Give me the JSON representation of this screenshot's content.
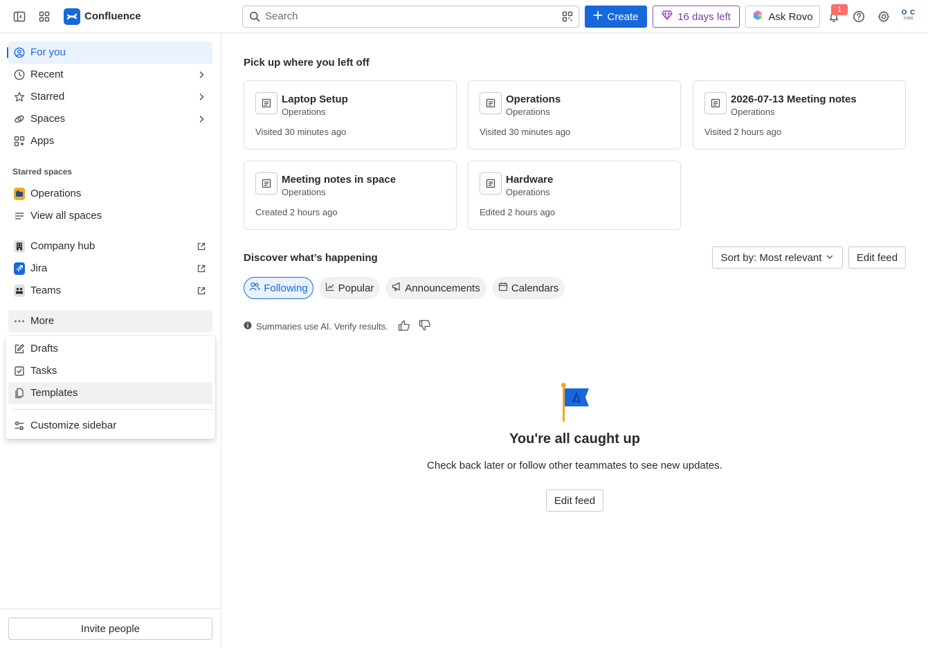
{
  "topbar": {
    "app_name": "Confluence",
    "search_placeholder": "Search",
    "create_label": "Create",
    "trial_label": "16 days left",
    "rovo_label": "Ask Rovo",
    "notification_count": "1",
    "avatar_initials": "O C",
    "avatar_subtext": "FORE"
  },
  "sidebar": {
    "nav": [
      {
        "label": "For you",
        "icon": "user-circle-icon"
      },
      {
        "label": "Recent",
        "icon": "clock-icon"
      },
      {
        "label": "Starred",
        "icon": "star-icon"
      },
      {
        "label": "Spaces",
        "icon": "spaces-icon"
      },
      {
        "label": "Apps",
        "icon": "apps-icon"
      }
    ],
    "starred_spaces_heading": "Starred spaces",
    "starred_spaces": [
      {
        "label": "Operations"
      },
      {
        "label": "View all spaces"
      }
    ],
    "external": [
      {
        "label": "Company hub"
      },
      {
        "label": "Jira"
      },
      {
        "label": "Teams"
      }
    ],
    "more_label": "More",
    "more_menu": [
      {
        "label": "Drafts",
        "icon": "pencil-icon"
      },
      {
        "label": "Tasks",
        "icon": "checkbox-icon"
      },
      {
        "label": "Templates",
        "icon": "template-icon"
      },
      {
        "label": "Customize sidebar",
        "icon": "customize-icon"
      }
    ],
    "invite_label": "Invite people"
  },
  "main": {
    "recent_heading": "Pick up where you left off",
    "recent_cards": [
      {
        "title": "Laptop Setup",
        "space": "Operations",
        "meta": "Visited 30 minutes ago"
      },
      {
        "title": "Operations",
        "space": "Operations",
        "meta": "Visited 30 minutes ago"
      },
      {
        "title": "2026-07-13 Meeting notes",
        "space": "Operations",
        "meta": "Visited 2 hours ago"
      },
      {
        "title": "Meeting notes in space",
        "space": "Operations",
        "meta": "Created 2 hours ago"
      },
      {
        "title": "Hardware",
        "space": "Operations",
        "meta": "Edited 2 hours ago"
      }
    ],
    "discover_heading": "Discover what’s happening",
    "sort_label": "Sort by: Most relevant",
    "edit_feed_label": "Edit feed",
    "tabs": [
      {
        "label": "Following"
      },
      {
        "label": "Popular"
      },
      {
        "label": "Announcements"
      },
      {
        "label": "Calendars"
      }
    ],
    "ai_note": "Summaries use AI. Verify results.",
    "empty_title": "You're all caught up",
    "empty_subtitle": "Check back later or follow other teammates to see new updates.",
    "empty_button": "Edit feed"
  },
  "colors": {
    "accent": "#1868db",
    "trial": "#964ac0",
    "badge": "#f87168"
  }
}
